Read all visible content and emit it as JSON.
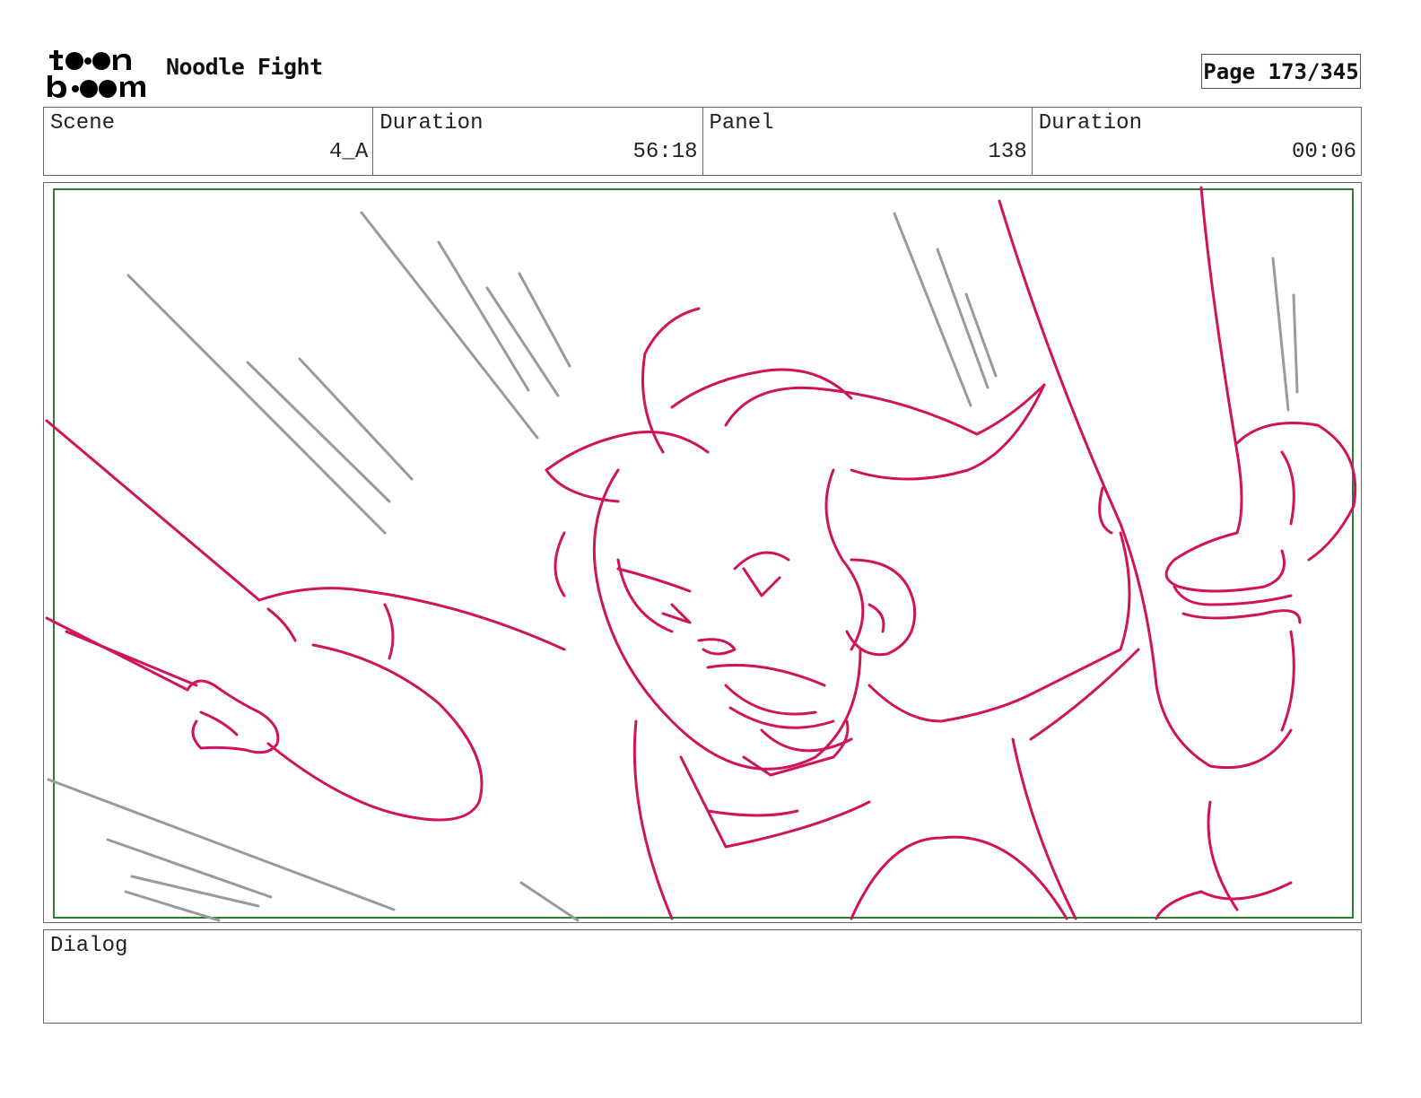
{
  "header": {
    "logo_text": "toon boom",
    "project_title": "Noodle Fight",
    "page_label": "Page 173/345"
  },
  "info": [
    {
      "label": "Scene",
      "value": "4_A"
    },
    {
      "label": "Duration",
      "value": "56:18"
    },
    {
      "label": "Panel",
      "value": "138"
    },
    {
      "label": "Duration",
      "value": "00:06"
    }
  ],
  "dialog": {
    "label": "Dialog",
    "text": ""
  },
  "colors": {
    "sketch_line": "#d0145a",
    "speed_line": "#9a9a9a",
    "safe_frame": "#2e7d32",
    "border": "#666666"
  }
}
